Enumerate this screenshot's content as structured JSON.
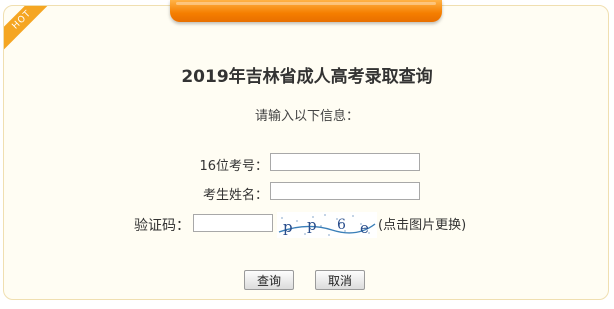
{
  "badge": {
    "text": "HOT"
  },
  "header": {
    "title": "2019年吉林省成人高考录取查询"
  },
  "form": {
    "hint": "请输入以下信息：",
    "fields": [
      {
        "label": "16位考号：",
        "value": ""
      },
      {
        "label": "考生姓名：",
        "value": ""
      },
      {
        "label": "验证码：",
        "value": ""
      }
    ],
    "captcha": {
      "text": "pp6e",
      "hint": "(点击图片更换)"
    }
  },
  "buttons": {
    "submit": "查询",
    "cancel": "取消"
  },
  "colors": {
    "accent": "#f57e00",
    "panel_bg": "#fffdf3",
    "panel_border": "#f0dfb0"
  }
}
